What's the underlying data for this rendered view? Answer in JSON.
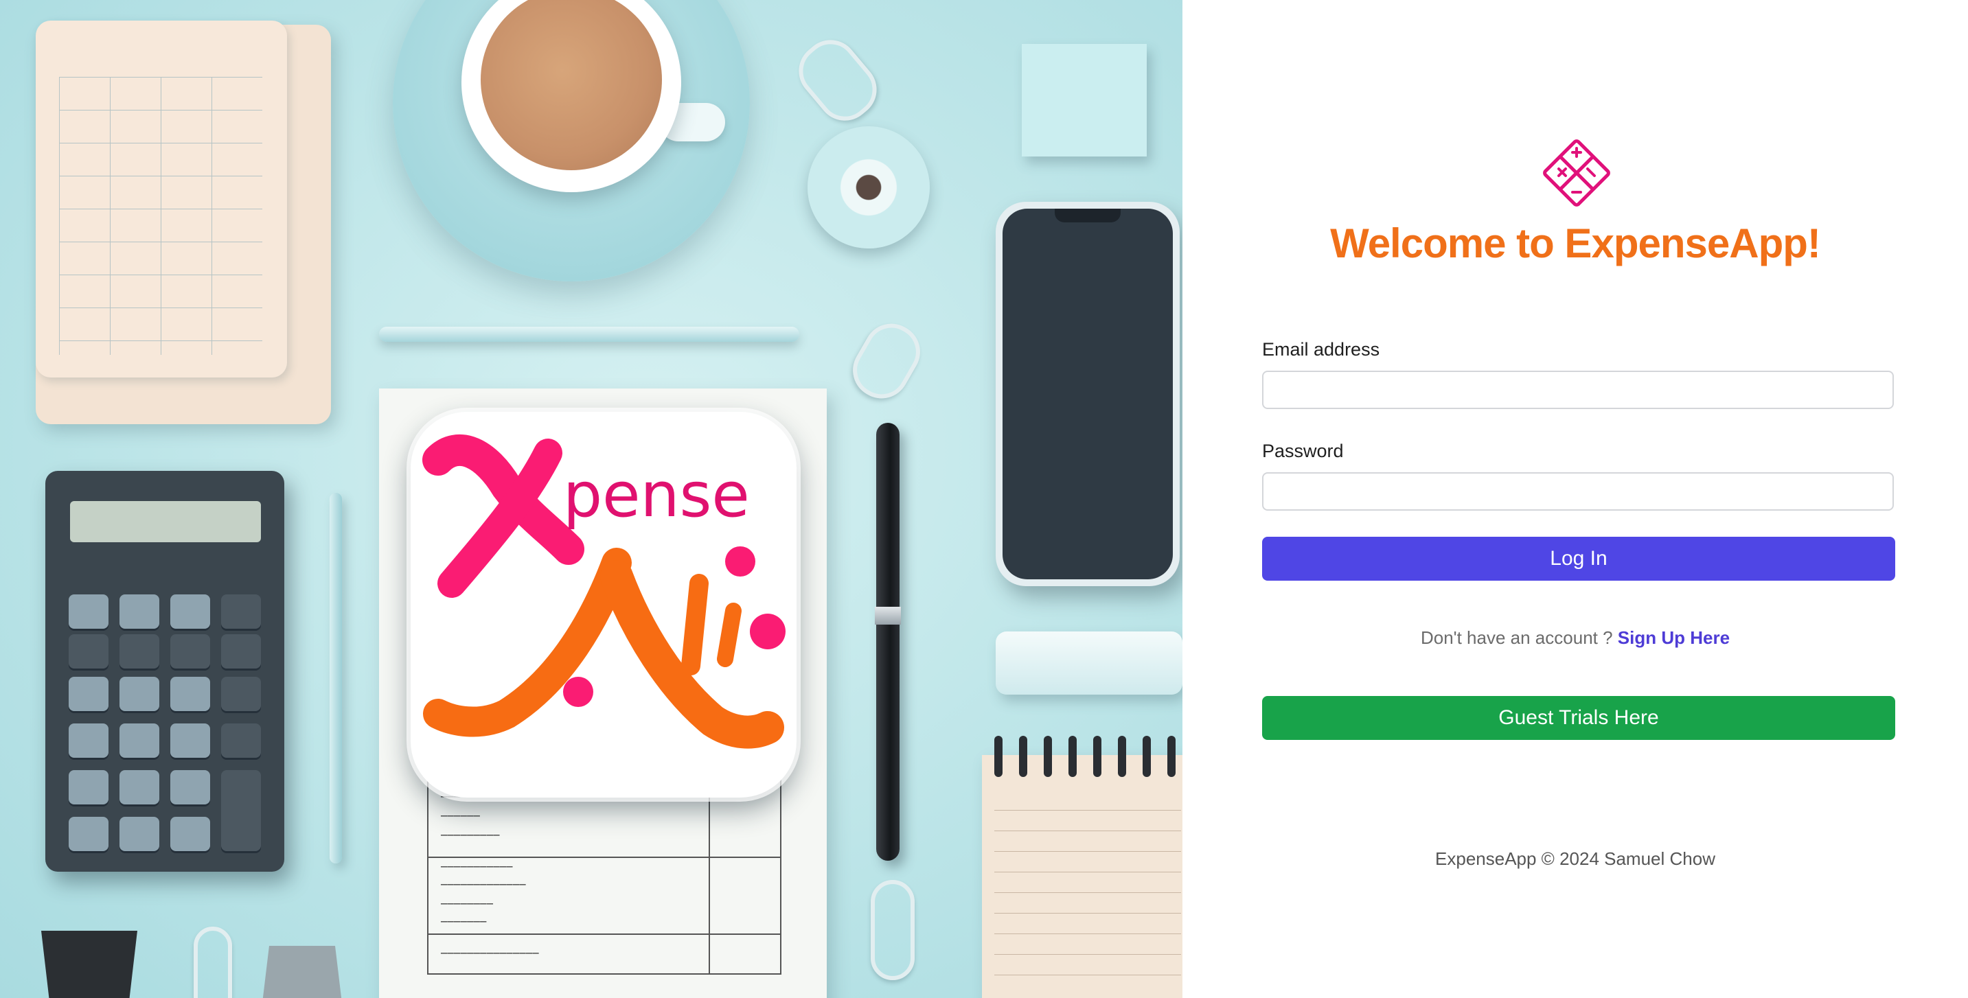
{
  "hero": {
    "logo_text": "pense",
    "logo_icon": "expense-ai-logo"
  },
  "login": {
    "brand_icon": "calculator-diamond-icon",
    "brand_color": "#e0117a",
    "title": "Welcome to ExpenseApp!",
    "title_color": "#f07019",
    "email_label": "Email address",
    "email_value": "",
    "password_label": "Password",
    "password_value": "",
    "login_button": "Log In",
    "login_color": "#4f46e5",
    "signup_prompt": "Don't have an account ?",
    "signup_link": "Sign Up Here",
    "guest_button": "Guest Trials Here",
    "guest_color": "#18a34a",
    "footer": "ExpenseApp © 2024 Samuel Chow"
  }
}
